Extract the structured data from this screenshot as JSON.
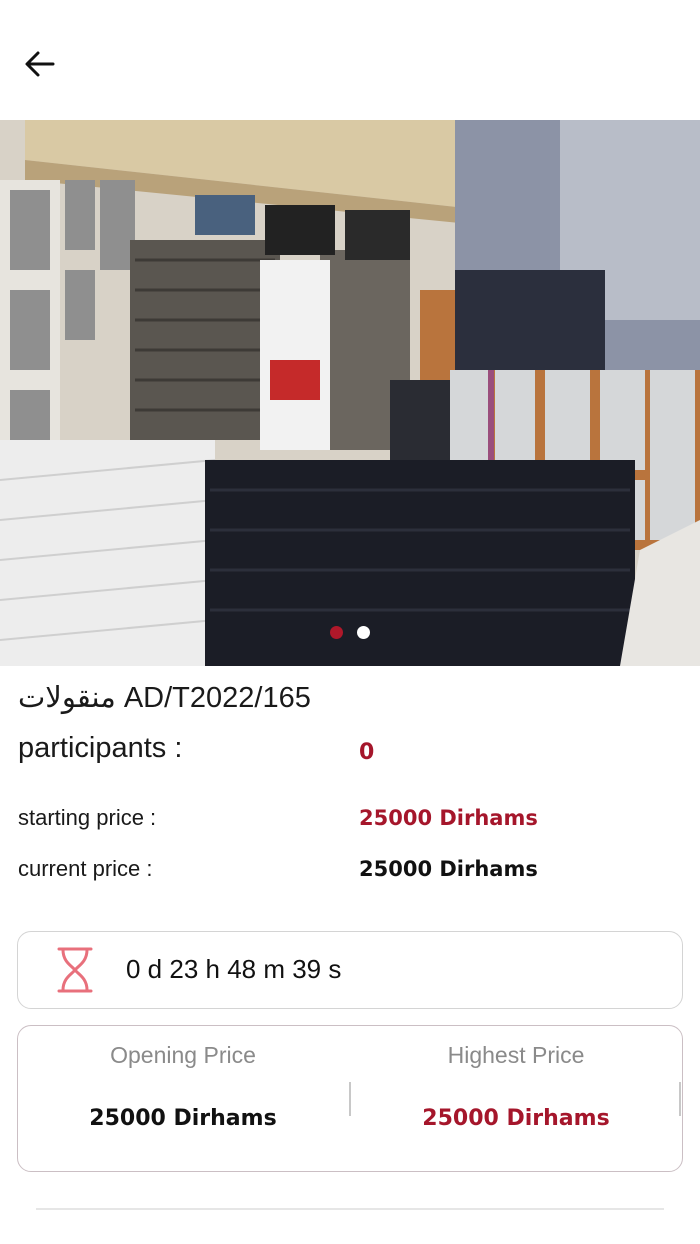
{
  "header": {
    "back_icon": "arrow-left-icon"
  },
  "gallery": {
    "total_images": 2,
    "active_index": 0,
    "active_dot_color": "#b0182a",
    "inactive_dot_color": "#ffffff"
  },
  "listing": {
    "title": "منقولات AD/T2022/165"
  },
  "stats": {
    "participants_label": "participants :",
    "participants_value": "0",
    "starting_price_label": "starting price :",
    "starting_price_value": "25000 Dirhams",
    "current_price_label": "current price :",
    "current_price_value": "25000 Dirhams"
  },
  "timer": {
    "icon": "hourglass-icon",
    "text": "0 d 23 h 48 m 39 s"
  },
  "prices": {
    "opening_label": "Opening Price",
    "opening_value": "25000 Dirhams",
    "highest_label": "Highest Price",
    "highest_value": "25000 Dirhams"
  },
  "colors": {
    "accent": "#a5162b",
    "icon_pink": "#e8707c",
    "text": "#111111"
  }
}
